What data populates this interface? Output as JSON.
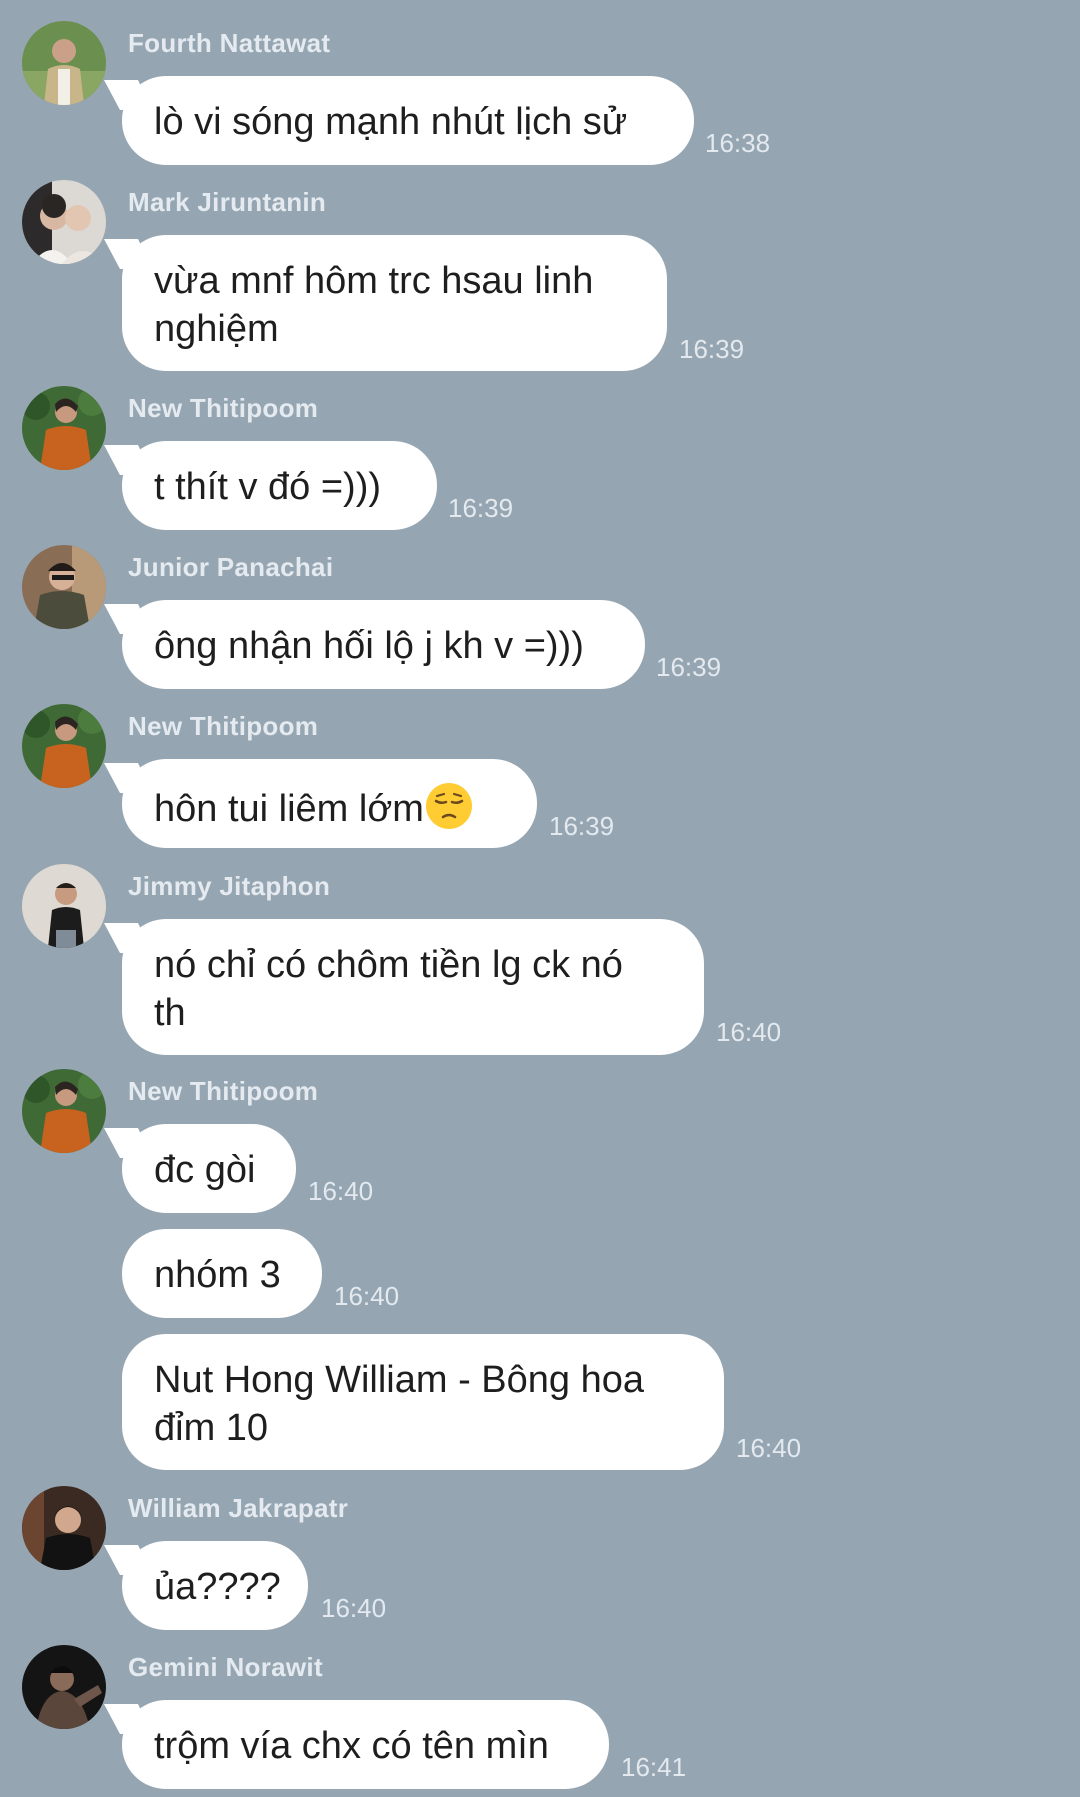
{
  "messages": [
    {
      "sender": "Fourth Nattawat",
      "text": "lò vi sóng mạnh nhút lịch sử",
      "time": "16:38"
    },
    {
      "sender": "Mark Jiruntanin",
      "text": "vừa mnf hôm trc hsau linh\nnghiệm",
      "time": "16:39"
    },
    {
      "sender": "New Thitipoom",
      "text": "t thít v đó =)))",
      "time": "16:39"
    },
    {
      "sender": "Junior Panachai",
      "text": "ông nhận hối lộ j kh v =)))",
      "time": "16:39"
    },
    {
      "sender": "New Thitipoom",
      "text": "hôn tui liêm lớm",
      "emoji": "pensive-face",
      "time": "16:39"
    },
    {
      "sender": "Jimmy Jitaphon",
      "text": "nó chỉ có chôm tiền lg ck nó\nth",
      "time": "16:40"
    },
    {
      "sender": "New Thitipoom",
      "text": "đc gòi",
      "time": "16:40"
    },
    {
      "text": "nhóm 3",
      "time": "16:40"
    },
    {
      "text": "Nut Hong William - Bông hoa\nđỉm 10",
      "time": "16:40"
    },
    {
      "sender": "William Jakrapatr",
      "text": "ủa????",
      "time": "16:40"
    },
    {
      "sender": "Gemini Norawit",
      "text": "trộm vía chx có tên mìn",
      "time": "16:41"
    }
  ],
  "colors": {
    "background": "#95a6b2",
    "bubble": "#ffffff",
    "meta_text": "#e4eaef"
  }
}
